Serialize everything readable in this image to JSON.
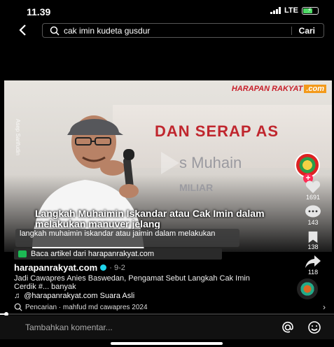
{
  "status": {
    "time": "11.39",
    "network": "LTE"
  },
  "search": {
    "query": "cak imin kudeta gusdur",
    "button": "Cari"
  },
  "video": {
    "logo_main": "HARAPAN RAKYAT",
    "logo_suffix": ".com",
    "side_credit": "Asep Sarifudin",
    "banner_line1": "DAN SERAP AS",
    "banner_line2": "s Muhain",
    "banner_line3": "MILIAR",
    "caption": "Langkah Muhaimin Iskandar atau Cak Imin dalam melakukan manuver jelang",
    "subtitle": "langkah muhaimin iskandar atau jaimin dalam melakukan"
  },
  "actions": {
    "likes": "1691",
    "comments": "143",
    "saves": "138",
    "shares": "118"
  },
  "post": {
    "article_link": "Baca artikel dari harapanrakyat.com",
    "author": "harapanrakyat.com",
    "date": "· 9-2",
    "description": "Jadi Cawapres Anies Baswedan, Pengamat Sebut Langkah Cak Imin Cerdik #... banyak",
    "sound": "@harapanrakyat.com Suara Asli"
  },
  "suggestion": "Pencarian · mahfud md cawapres 2024",
  "comment": {
    "placeholder": "Tambahkan komentar..."
  },
  "playback": {
    "progress": 0.02
  }
}
